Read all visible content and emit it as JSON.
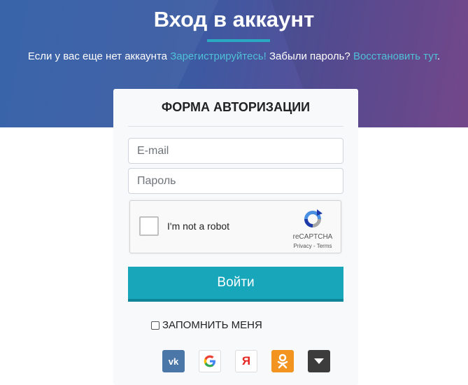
{
  "hero": {
    "title": "Вход в аккаунт",
    "sub_text1": "Если у вас еще нет аккаунта ",
    "register_link": "Зарегистрируйтесь!",
    "sub_text2": " Забыли пароль? ",
    "restore_link": "Восстановить тут",
    "sub_text3": "."
  },
  "form": {
    "title": "ФОРМА АВТОРИЗАЦИИ",
    "email_placeholder": "E-mail",
    "password_placeholder": "Пароль",
    "submit_label": "Войти",
    "remember_label": "ЗАПОМНИТЬ МЕНЯ"
  },
  "captcha": {
    "label": "I'm not a robot",
    "brand": "reCAPTCHA",
    "links": "Privacy - Terms"
  },
  "socials": [
    {
      "name": "vk",
      "icon": "vk-icon",
      "text": "vk"
    },
    {
      "name": "google",
      "icon": "google-icon",
      "text": ""
    },
    {
      "name": "yandex",
      "icon": "yandex-icon",
      "text": "Я"
    },
    {
      "name": "odnoklassniki",
      "icon": "odnoklassniki-icon",
      "text": ""
    },
    {
      "name": "more",
      "icon": "chevron-down-icon",
      "text": ""
    }
  ],
  "colors": {
    "accent": "#17a6ba",
    "link": "#4fc0d6",
    "hero_start": "#2f5ca6",
    "hero_end": "#7b4c93"
  }
}
